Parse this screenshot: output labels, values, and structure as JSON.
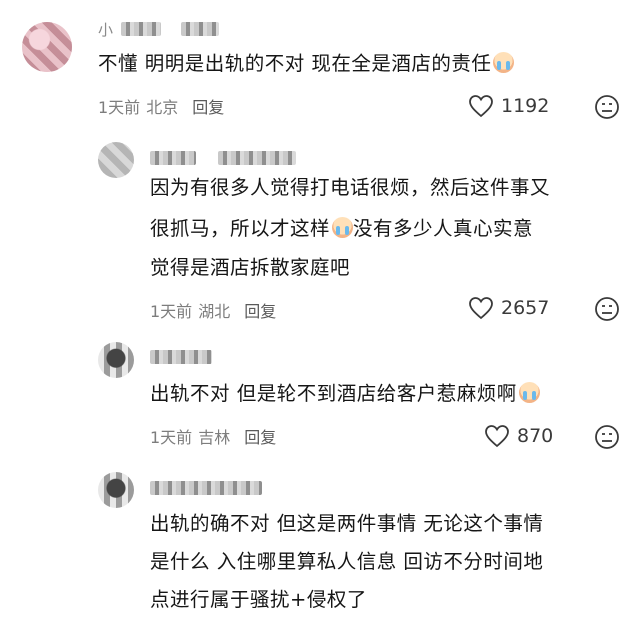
{
  "comments": [
    {
      "username": "小",
      "text": "不懂 明明是出轨的不对 现在全是酒店的责任",
      "time": "1天前",
      "location": "北京",
      "reply": "回复",
      "likes": "1192"
    },
    {
      "text_line1": "因为有很多人觉得打电话很烦，然后这件事又",
      "text_line2a": "很抓马，所以才这样",
      "text_line2b": "没有多少人真心实意",
      "text_line3": "觉得是酒店拆散家庭吧",
      "time": "1天前",
      "location": "湖北",
      "reply": "回复",
      "likes": "2657"
    },
    {
      "text": "出轨不对 但是轮不到酒店给客户惹麻烦啊",
      "time": "1天前",
      "location": "吉林",
      "reply": "回复",
      "likes": "870"
    },
    {
      "text_line1": "出轨的确不对 但这是两件事情 无论这个事情",
      "text_line2": "是什么 入住哪里算私人信息 回访不分时间地",
      "text_line3": "点进行属于骚扰+侵权了"
    }
  ],
  "icons": {
    "like": "heart-outline-icon",
    "dislike": "frown-face-icon",
    "emoji": "crying-face-emoji"
  },
  "colors": {
    "text": "#161616",
    "meta": "#7d7d7d",
    "username": "#8a8a8a"
  }
}
